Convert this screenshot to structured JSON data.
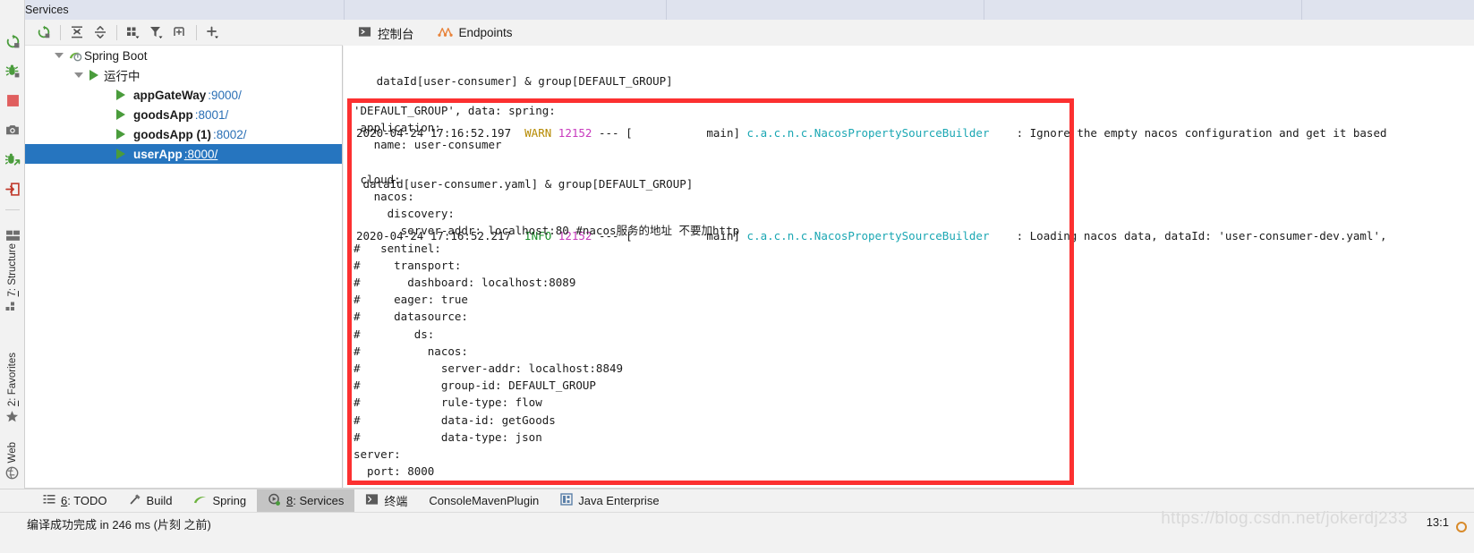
{
  "window": {
    "top_tab_title": "Services"
  },
  "left_tool_window_bar": {
    "tabs": [
      {
        "label_prefix": "7",
        "label": ": Structure",
        "icon": "structure-icon"
      },
      {
        "label_prefix": "2",
        "label": ": Favorites",
        "icon": "star-icon"
      },
      {
        "label_prefix": "",
        "label": "Web",
        "icon": "web-globe-icon"
      }
    ]
  },
  "services_side_icons": [
    {
      "name": "rerun-icon"
    },
    {
      "name": "debug-rerun-icon"
    },
    {
      "name": "stop-icon"
    },
    {
      "name": "camera-snapshot-icon"
    },
    {
      "name": "attach-debugger-icon"
    },
    {
      "name": "jump-to-source-icon"
    },
    {
      "name": "layout-settings-icon"
    }
  ],
  "services_toolbar": {
    "buttons": [
      {
        "name": "rerun-icon",
        "tooltip": "Rerun"
      },
      {
        "name": "expand-all-icon",
        "tooltip": "Expand All"
      },
      {
        "name": "collapse-all-icon",
        "tooltip": "Collapse All"
      },
      {
        "name": "group-by-icon",
        "tooltip": "Group By"
      },
      {
        "name": "filter-icon",
        "tooltip": "Filter"
      },
      {
        "name": "show-configurations-icon",
        "tooltip": "Show Configurations"
      },
      {
        "name": "add-icon",
        "tooltip": "Add Service"
      }
    ]
  },
  "services_tree": {
    "root": {
      "label": "Spring Boot",
      "icon": "spring-boot-icon",
      "expanded": true
    },
    "group": {
      "label": "运行中",
      "icon": "run-icon",
      "expanded": true
    },
    "items": [
      {
        "name": "appGateWay",
        "port": ":9000/",
        "selected": false
      },
      {
        "name": "goodsApp",
        "port": ":8001/",
        "selected": false
      },
      {
        "name": "goodsApp (1)",
        "port": ":8002/",
        "selected": false
      },
      {
        "name": "userApp",
        "port": ":8000/",
        "selected": true
      }
    ]
  },
  "console": {
    "tabs": [
      {
        "label": "控制台",
        "icon": "console-icon",
        "active": true
      },
      {
        "label": "Endpoints",
        "icon": "endpoints-icon",
        "active": false
      }
    ],
    "log_lines": [
      {
        "clipped": true,
        "segments": [
          {
            "text": "   dataId[user-consumer] & group[DEFAULT_GROUP]",
            "cls": "c-msg"
          }
        ]
      },
      {
        "segments": [
          {
            "text": "2020-04-24 17:16:52.197",
            "cls": "c-ts"
          },
          {
            "text": "  ",
            "cls": "c-msg"
          },
          {
            "text": "WARN",
            "cls": "c-warn"
          },
          {
            "text": " ",
            "cls": "c-msg"
          },
          {
            "text": "12152",
            "cls": "c-pid"
          },
          {
            "text": " --- [",
            "cls": "c-dash"
          },
          {
            "text": "           main",
            "cls": "c-thread"
          },
          {
            "text": "] ",
            "cls": "c-dash"
          },
          {
            "text": "c.a.c.n.c.NacosPropertySourceBuilder",
            "cls": "c-class"
          },
          {
            "text": "    : Ignore the empty nacos configuration and get it based",
            "cls": "c-msg"
          }
        ]
      },
      {
        "segments": [
          {
            "text": " dataId[user-consumer.yaml] & group[DEFAULT_GROUP]",
            "cls": "c-msg"
          }
        ]
      },
      {
        "clipped_bottom": true,
        "segments": [
          {
            "text": "2020-04-24 17:16:52.217",
            "cls": "c-ts"
          },
          {
            "text": "  ",
            "cls": "c-msg"
          },
          {
            "text": "INFO",
            "cls": "c-info"
          },
          {
            "text": " ",
            "cls": "c-msg"
          },
          {
            "text": "12152",
            "cls": "c-pid"
          },
          {
            "text": " --- [",
            "cls": "c-dash"
          },
          {
            "text": "           main",
            "cls": "c-thread"
          },
          {
            "text": "] ",
            "cls": "c-dash"
          },
          {
            "text": "c.a.c.n.c.NacosPropertySourceBuilder",
            "cls": "c-class"
          },
          {
            "text": "    : Loading nacos data, dataId: 'user-consumer-dev.yaml',",
            "cls": "c-msg"
          }
        ]
      }
    ],
    "yaml_block": "'DEFAULT_GROUP', data: spring:\n application:\n   name: user-consumer\n\n cloud:\n   nacos:\n     discovery:\n       server-addr: localhost:80 #nacos服务的地址 不要加http\n#   sentinel:\n#     transport:\n#       dashboard: localhost:8089\n#     eager: true\n#     datasource:\n#        ds:\n#          nacos:\n#            server-addr: localhost:8849\n#            group-id: DEFAULT_GROUP\n#            rule-type: flow\n#            data-id: getGoods\n#            data-type: json\nserver:\n  port: 8000",
    "annotation": {
      "name": "red-highlight-box",
      "color": "#fc3030"
    }
  },
  "bottom_tabs": [
    {
      "num": "6",
      "label": ": TODO",
      "icon": "todo-icon",
      "active": false
    },
    {
      "num": "",
      "label": "Build",
      "icon": "build-hammer-icon",
      "active": false
    },
    {
      "num": "",
      "label": "Spring",
      "icon": "spring-leaf-icon",
      "active": false
    },
    {
      "num": "8",
      "label": ": Services",
      "icon": "services-icon",
      "active": true
    },
    {
      "num": "",
      "label": "终端",
      "icon": "terminal-icon",
      "active": false
    },
    {
      "num": "",
      "label": "ConsoleMavenPlugin",
      "icon": "",
      "active": false
    },
    {
      "num": "",
      "label": "Java Enterprise",
      "icon": "java-enterprise-icon",
      "active": false
    }
  ],
  "status_bar": {
    "message": "编译成功完成 in 246 ms (片刻 之前)",
    "caret_position": "13:1",
    "watermark": "https://blog.csdn.net/jokerdj233"
  },
  "colors": {
    "selection_blue": "#2675bf",
    "link_blue": "#2a6fb5",
    "annotation_red": "#fc3030",
    "run_green": "#4a9c3c",
    "warn_yellow": "#b58900",
    "info_green": "#1a8f2a",
    "pid_magenta": "#c83bbe",
    "class_cyan": "#1ba7b3"
  }
}
